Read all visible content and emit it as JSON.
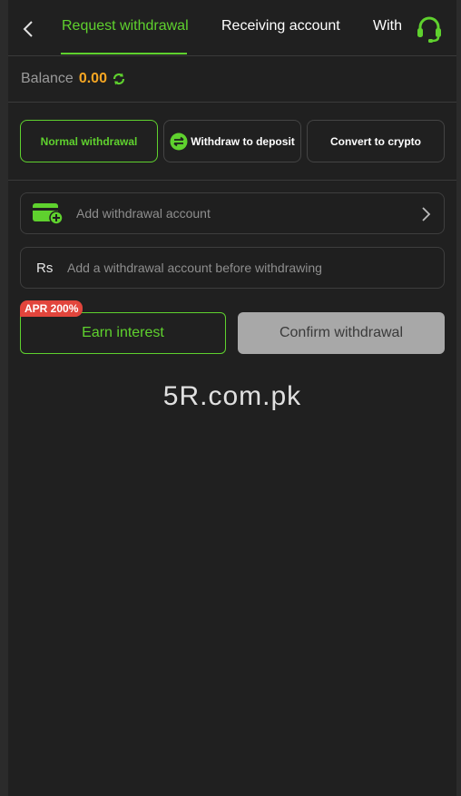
{
  "header": {
    "tabs": [
      {
        "label": "Request withdrawal",
        "active": true
      },
      {
        "label": "Receiving account",
        "active": false
      },
      {
        "label": "With",
        "active": false
      }
    ],
    "back_icon": "chevron-left-icon",
    "support_icon": "headset-icon"
  },
  "balance": {
    "label": "Balance",
    "value": "0.00",
    "refresh_icon": "refresh-icon"
  },
  "methods": [
    {
      "label": "Normal withdrawal",
      "active": true
    },
    {
      "label": "Withdraw to deposit",
      "active": false,
      "icon": "swap-icon"
    },
    {
      "label": "Convert to crypto",
      "active": false
    }
  ],
  "account": {
    "add_label": "Add withdrawal account",
    "currency_symbol": "Rs",
    "amount_placeholder": "Add a withdrawal account before withdrawing"
  },
  "actions": {
    "apr_badge": "APR 200%",
    "earn_label": "Earn interest",
    "confirm_label": "Confirm withdrawal"
  },
  "watermark": "5R.com.pk",
  "colors": {
    "accent": "#5fd12e",
    "balance": "#f5a623",
    "badge": "#e2453c",
    "background": "#202020"
  }
}
